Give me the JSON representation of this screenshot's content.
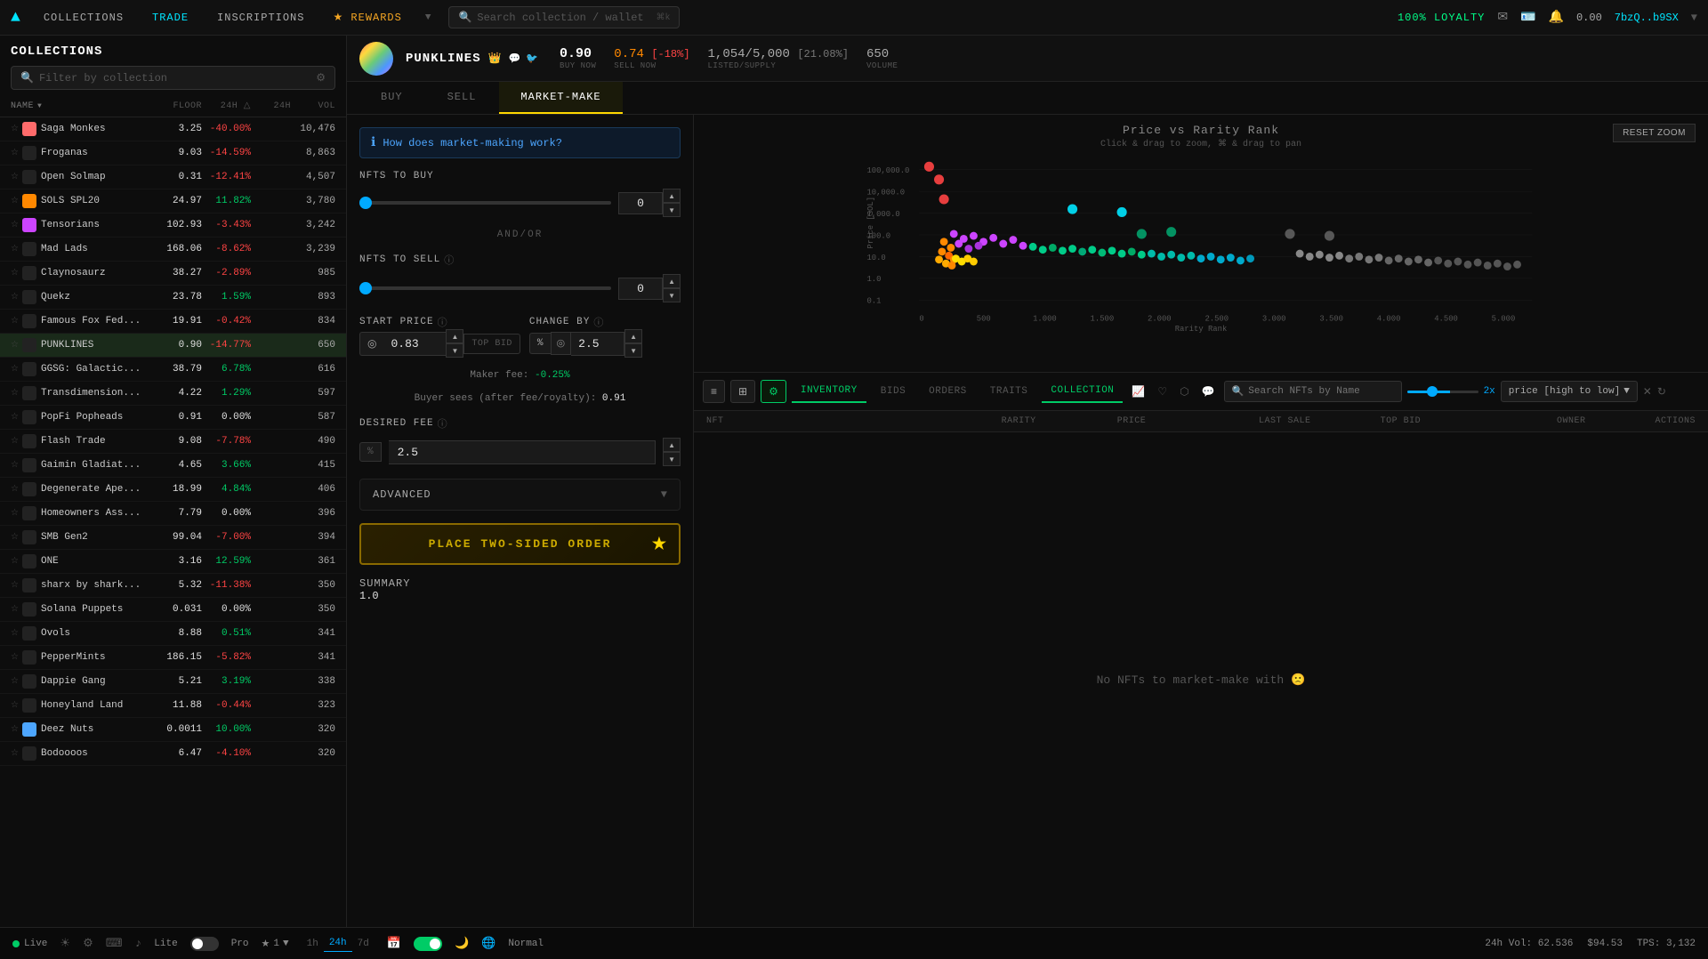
{
  "app": {
    "logo": "▲",
    "nav": [
      "COLLECTIONS",
      "TRADE",
      "INSCRIPTIONS"
    ],
    "nav_active": "TRADE",
    "rewards": "★ REWARDS",
    "search_placeholder": "Search collection / wallet",
    "search_shortcut": "⌘k",
    "loyalty_label": "100% LOYALTY",
    "wallet_balance": "0.00",
    "wallet_address": "7bzQ..b9SX"
  },
  "sidebar": {
    "title": "COLLECTIONS",
    "search_placeholder": "Filter by collection",
    "col_headers": {
      "name": "NAME",
      "floor": "FLOOR",
      "change_24h": "24H △",
      "change_24h2": "24H",
      "vol": "VOL"
    },
    "collections": [
      {
        "name": "Saga Monkes",
        "floor": "3.25",
        "change": "-40.00%",
        "change2": "",
        "vol": "10,476",
        "neg": true,
        "has_thumb": true
      },
      {
        "name": "Froganas",
        "floor": "9.03",
        "change": "-14.59%",
        "change2": "",
        "vol": "8,863",
        "neg": true
      },
      {
        "name": "Open Solmap",
        "floor": "0.31",
        "change": "-12.41%",
        "change2": "",
        "vol": "4,507",
        "neg": true
      },
      {
        "name": "SOLS SPL20",
        "floor": "24.97",
        "change": "11.82%",
        "change2": "",
        "vol": "3,780",
        "pos": true,
        "has_thumb": true
      },
      {
        "name": "Tensorians",
        "floor": "102.93",
        "change": "-3.43%",
        "change2": "",
        "vol": "3,242",
        "neg": true,
        "has_thumb": true
      },
      {
        "name": "Mad Lads",
        "floor": "168.06",
        "change": "-8.62%",
        "change2": "",
        "vol": "3,239",
        "neg": true
      },
      {
        "name": "Claynosaurz",
        "floor": "38.27",
        "change": "-2.89%",
        "change2": "",
        "vol": "985",
        "neg": true
      },
      {
        "name": "Quekz",
        "floor": "23.78",
        "change": "1.59%",
        "change2": "",
        "vol": "893",
        "pos": true
      },
      {
        "name": "Famous Fox Fed...",
        "floor": "19.91",
        "change": "-0.42%",
        "change2": "",
        "vol": "834",
        "neg": true
      },
      {
        "name": "PUNKLINES",
        "floor": "0.90",
        "change": "-14.77%",
        "change2": "",
        "vol": "650",
        "neg": true,
        "selected": true
      },
      {
        "name": "GGSG: Galactic...",
        "floor": "38.79",
        "change": "6.78%",
        "change2": "",
        "vol": "616",
        "pos": true
      },
      {
        "name": "Transdimension...",
        "floor": "4.22",
        "change": "1.29%",
        "change2": "",
        "vol": "597",
        "pos": true
      },
      {
        "name": "PopFi Popheads",
        "floor": "0.91",
        "change": "0.00%",
        "change2": "",
        "vol": "587"
      },
      {
        "name": "Flash Trade",
        "floor": "9.08",
        "change": "-7.78%",
        "change2": "",
        "vol": "490",
        "neg": true
      },
      {
        "name": "Gaimin Gladiat...",
        "floor": "4.65",
        "change": "3.66%",
        "change2": "",
        "vol": "415",
        "pos": true
      },
      {
        "name": "Degenerate Ape...",
        "floor": "18.99",
        "change": "4.84%",
        "change2": "",
        "vol": "406",
        "pos": true
      },
      {
        "name": "Homeowners Ass...",
        "floor": "7.79",
        "change": "0.00%",
        "change2": "",
        "vol": "396"
      },
      {
        "name": "SMB Gen2",
        "floor": "99.04",
        "change": "-7.00%",
        "change2": "",
        "vol": "394",
        "neg": true
      },
      {
        "name": "ONE",
        "floor": "3.16",
        "change": "12.59%",
        "change2": "",
        "vol": "361",
        "pos": true
      },
      {
        "name": "sharx by shark...",
        "floor": "5.32",
        "change": "-11.38%",
        "change2": "",
        "vol": "350",
        "neg": true
      },
      {
        "name": "Solana Puppets",
        "floor": "0.031",
        "change": "0.00%",
        "change2": "",
        "vol": "350"
      },
      {
        "name": "Ovols",
        "floor": "8.88",
        "change": "0.51%",
        "change2": "",
        "vol": "341",
        "pos": true
      },
      {
        "name": "PepperMints",
        "floor": "186.15",
        "change": "-5.82%",
        "change2": "",
        "vol": "341",
        "neg": true
      },
      {
        "name": "Dappie Gang",
        "floor": "5.21",
        "change": "3.19%",
        "change2": "",
        "vol": "338",
        "pos": true
      },
      {
        "name": "Honeyland Land",
        "floor": "11.88",
        "change": "-0.44%",
        "change2": "",
        "vol": "323",
        "neg": true
      },
      {
        "name": "Deez Nuts",
        "floor": "0.0011",
        "change": "10.00%",
        "change2": "",
        "vol": "320",
        "pos": true,
        "has_thumb": true
      },
      {
        "name": "Bodoooos",
        "floor": "6.47",
        "change": "-4.10%",
        "change2": "",
        "vol": "320",
        "neg": true
      }
    ]
  },
  "collection": {
    "name": "PUNKLINES",
    "crown": "👑",
    "buy_now": "0.90",
    "buy_label": "BUY NOW",
    "sell_now_val": "0.74",
    "sell_now_change": "[-18%]",
    "sell_label": "SELL NOW",
    "listed": "1,054/5,000",
    "listed_pct": "[21.08%]",
    "listed_label": "LISTED/SUPPLY",
    "volume": "650",
    "volume_label": "VOLUME"
  },
  "tabs": {
    "buy": "BUY",
    "sell": "SELL",
    "market_make": "MARKET-MAKE",
    "active": "MARKET-MAKE"
  },
  "market_make": {
    "info_text": "How does market-making work?",
    "nfts_to_buy_label": "NFTS TO BUY",
    "nfts_to_buy_val": "0",
    "andor": "AND/OR",
    "nfts_to_sell_label": "NFTS TO SELL",
    "nfts_to_sell_val": "0",
    "start_price_label": "START PRICE",
    "change_by_label": "CHANGE BY",
    "start_price_val": "0.83",
    "top_bid_label": "TOP BID",
    "change_by_val": "2.5",
    "maker_fee_label": "Maker fee:",
    "maker_fee_val": "-0.25%",
    "buyer_sees_label": "Buyer sees (after fee/royalty):",
    "buyer_sees_val": "0.91",
    "desired_fee_label": "DESIRED FEE",
    "desired_fee_val": "2.5",
    "advanced_label": "ADVANCED",
    "place_order_label": "PLACE TWO-SIDED ORDER",
    "summary_label": "SUMMARY",
    "summary_val": "1.0"
  },
  "chart": {
    "title": "Price vs Rarity Rank",
    "subtitle": "Click & drag to zoom, ⌘ & drag to pan",
    "reset_zoom": "RESET ZOOM",
    "y_labels": [
      "100,000.0",
      "10,000.0",
      "1,000.0",
      "100.0",
      "10.0",
      "1.0",
      "0.1"
    ],
    "x_labels": [
      "0",
      "500",
      "1.000",
      "1.500",
      "2.000",
      "2.500",
      "3.000",
      "3.500",
      "4.000",
      "4.500",
      "5.000"
    ],
    "y_axis_label": "Price [SOL]",
    "x_axis_label": "Rarity Rank"
  },
  "table": {
    "tabs": [
      "INVENTORY",
      "BIDS",
      "ORDERS",
      "TRAITS",
      "COLLECTION"
    ],
    "active_tab": "INVENTORY",
    "search_placeholder": "Search NFTs by Name",
    "slider_val": "2x",
    "sort_label": "price [high to low]",
    "headers": {
      "nft": "NFT",
      "rarity": "RARITY",
      "price": "PRICE",
      "last_sale": "LAST SALE",
      "top_bid": "TOP BID",
      "owner": "OWNER",
      "actions": "ACTIONS"
    },
    "empty_label": "No NFTs to market-make with"
  },
  "bottom_bar": {
    "live_label": "Live",
    "vol_label": "24h Vol: 62.536",
    "price_label": "$94.53",
    "tps_label": "TPS: 3,132",
    "lite_label": "Lite",
    "pro_label": "Pro",
    "time_options": [
      "1h",
      "24h",
      "7d"
    ],
    "time_active": "24h",
    "mode_label": "Normal"
  }
}
